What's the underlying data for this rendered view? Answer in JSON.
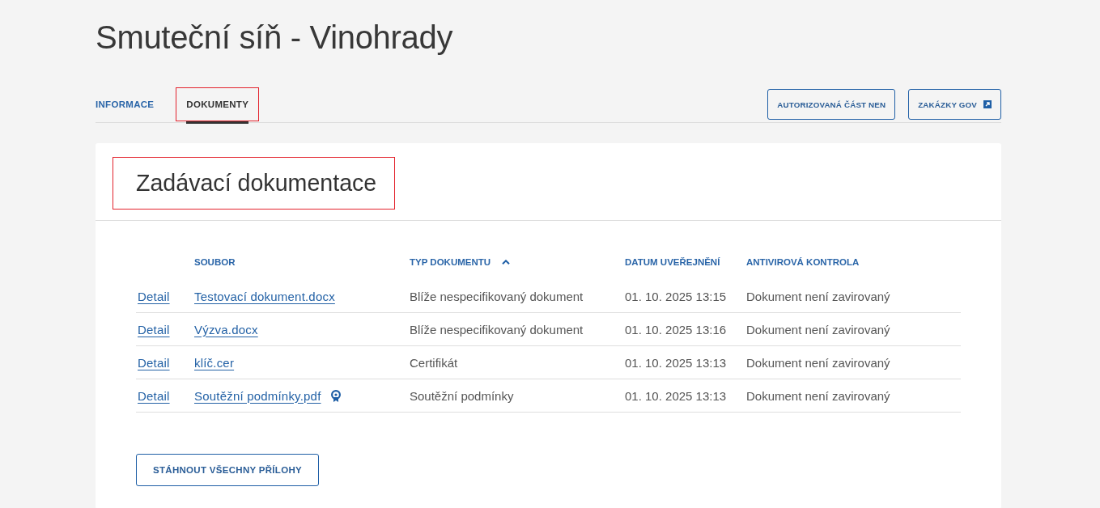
{
  "page": {
    "title": "Smuteční síň - Vinohrady"
  },
  "tabs": [
    {
      "label": "INFORMACE",
      "selected": false,
      "highlighted": false
    },
    {
      "label": "DOKUMENTY",
      "selected": true,
      "highlighted": true
    }
  ],
  "actions": [
    {
      "label": "AUTORIZOVANÁ ČÁST NEN",
      "external": false
    },
    {
      "label": "ZAKÁZKY GOV",
      "external": true
    }
  ],
  "section": {
    "title": "Zadávací dokumentace",
    "highlighted": true
  },
  "table": {
    "columns": [
      {
        "label": "SOUBOR",
        "sorted": false
      },
      {
        "label": "TYP DOKUMENTU",
        "sorted": true
      },
      {
        "label": "DATUM UVEŘEJNĚNÍ",
        "sorted": false
      },
      {
        "label": "ANTIVIROVÁ KONTROLA",
        "sorted": false
      }
    ],
    "rows": [
      {
        "detail": "Detail",
        "file": "Testovací dokument.docx",
        "signed": false,
        "type": "Blíže nespecifikovaný dokument",
        "date": "01. 10. 2025 13:15",
        "antivirus": "Dokument není zavirovaný"
      },
      {
        "detail": "Detail",
        "file": "Výzva.docx",
        "signed": false,
        "type": "Blíže nespecifikovaný dokument",
        "date": "01. 10. 2025 13:16",
        "antivirus": "Dokument není zavirovaný"
      },
      {
        "detail": "Detail",
        "file": "klíč.cer",
        "signed": false,
        "type": "Certifikát",
        "date": "01. 10. 2025 13:13",
        "antivirus": "Dokument není zavirovaný"
      },
      {
        "detail": "Detail",
        "file": "Soutěžní podmínky.pdf",
        "signed": true,
        "type": "Soutěžní podmínky",
        "date": "01. 10. 2025 13:13",
        "antivirus": "Dokument není zavirovaný"
      }
    ]
  },
  "download_all": {
    "label": "STÁHNOUT VŠECHNY PŘÍLOHY"
  }
}
